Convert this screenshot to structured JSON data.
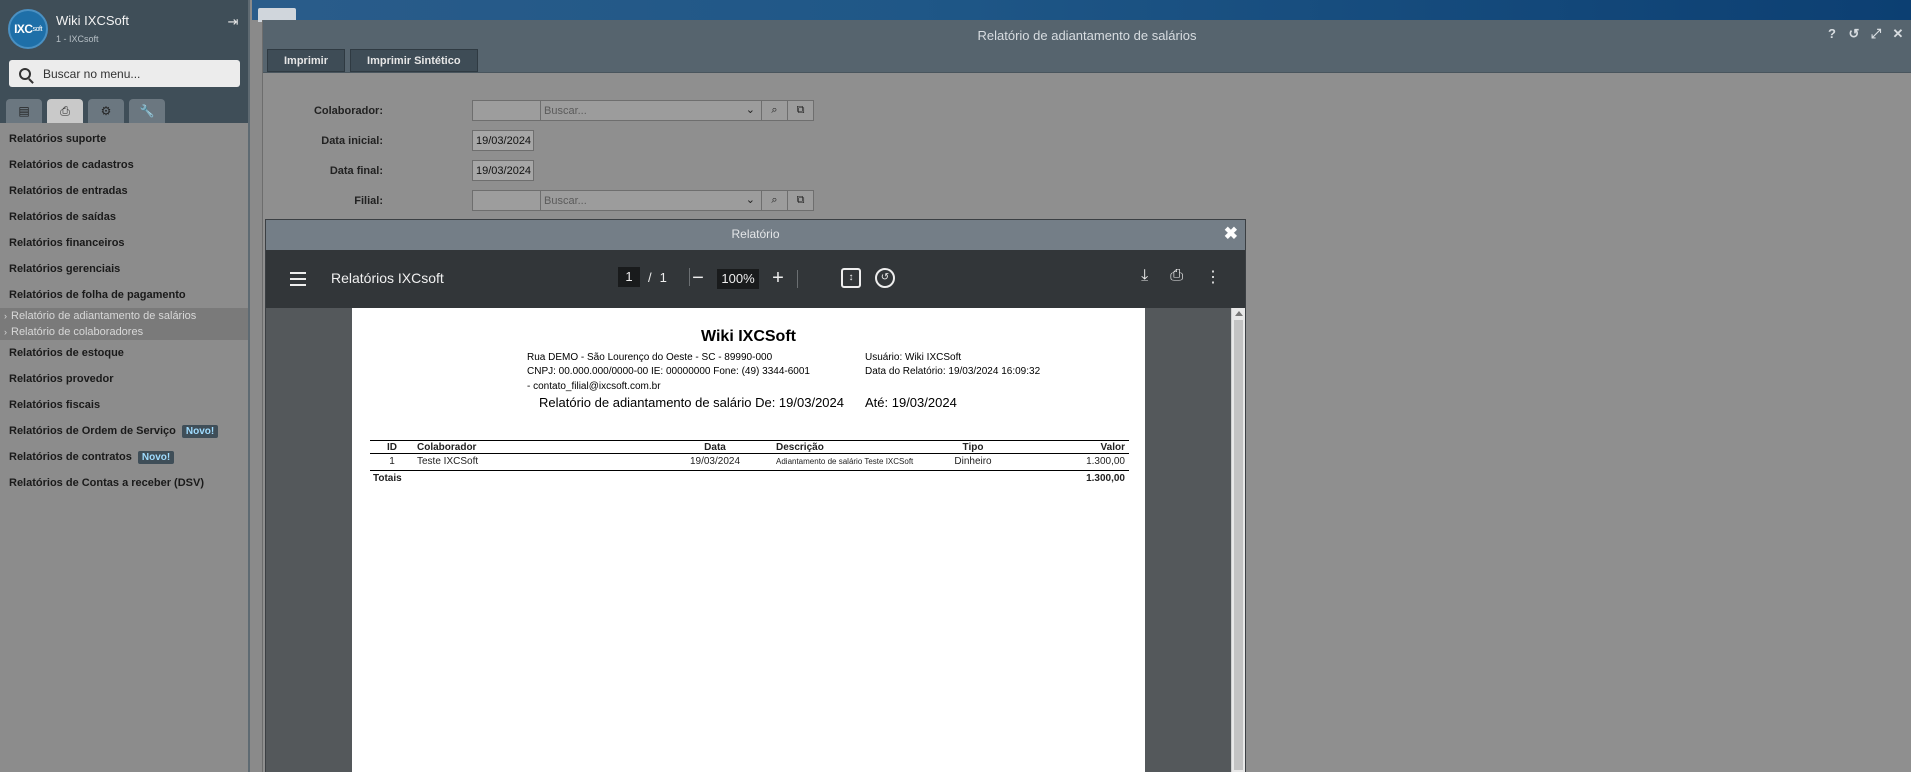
{
  "sidebar": {
    "logo_text": "IXC",
    "logo_small": "soft",
    "title": "Wiki IXCSoft",
    "subtitle": "1 - IXCsoft",
    "search_placeholder": "Buscar no menu...",
    "tabs": [
      "table-icon",
      "print-icon",
      "gears-icon",
      "wrench-icon"
    ],
    "items": [
      {
        "label": "Relatórios suporte"
      },
      {
        "label": "Relatórios de cadastros"
      },
      {
        "label": "Relatórios de entradas"
      },
      {
        "label": "Relatórios de saídas"
      },
      {
        "label": "Relatórios financeiros"
      },
      {
        "label": "Relatórios gerenciais"
      },
      {
        "label": "Relatórios de folha de pagamento"
      },
      {
        "label": "Relatórios de estoque"
      },
      {
        "label": "Relatórios provedor"
      },
      {
        "label": "Relatórios fiscais"
      },
      {
        "label": "Relatórios de Ordem de Serviço",
        "badge": "Novo!"
      },
      {
        "label": "Relatórios de contratos",
        "badge": "Novo!"
      },
      {
        "label": "Relatórios de Contas a receber (DSV)"
      }
    ],
    "subitems": [
      "Relatório de adiantamento de salários",
      "Relatório de colaboradores"
    ]
  },
  "window": {
    "title": "Relatório de adiantamento de salários",
    "toolbar": {
      "print": "Imprimir",
      "print_synthetic": "Imprimir Sintético"
    },
    "form": {
      "colaborador_label": "Colaborador:",
      "colaborador_placeholder": "Buscar...",
      "data_inicial_label": "Data inicial:",
      "data_inicial_value": "19/03/2024",
      "data_final_label": "Data final:",
      "data_final_value": "19/03/2024",
      "filial_label": "Filial:",
      "filial_placeholder": "Buscar..."
    }
  },
  "modal": {
    "title": "Relatório",
    "viewer": {
      "name": "Relatórios IXCsoft",
      "page_current": "1",
      "page_separator": "/",
      "page_total": "1",
      "zoom": "100%"
    },
    "report": {
      "company": "Wiki IXCSoft",
      "address": "Rua DEMO - São Lourenço do Oeste - SC - 89990-000",
      "cnpj_line": "CNPJ: 00.000.000/0000-00  IE: 00000000  Fone: (49) 3344-6001",
      "email_line": " - contato_filial@ixcsoft.com.br",
      "user_line": "Usuário: Wiki IXCSoft",
      "date_line": "Data do Relatório: 19/03/2024 16:09:32",
      "heading_from": "Relatório de adiantamento de salário De: 19/03/2024",
      "heading_to": "Até: 19/03/2024",
      "columns": {
        "id": "ID",
        "colaborador": "Colaborador",
        "data": "Data",
        "descricao": "Descrição",
        "tipo": "Tipo",
        "valor": "Valor"
      },
      "rows": [
        {
          "id": "1",
          "colaborador": "Teste IXCSoft",
          "data": "19/03/2024",
          "descricao": "Adiantamento de salário Teste IXCSoft",
          "tipo": "Dinheiro",
          "valor": "1.300,00"
        }
      ],
      "totals_label": "Totais",
      "totals_value": "1.300,00"
    }
  }
}
